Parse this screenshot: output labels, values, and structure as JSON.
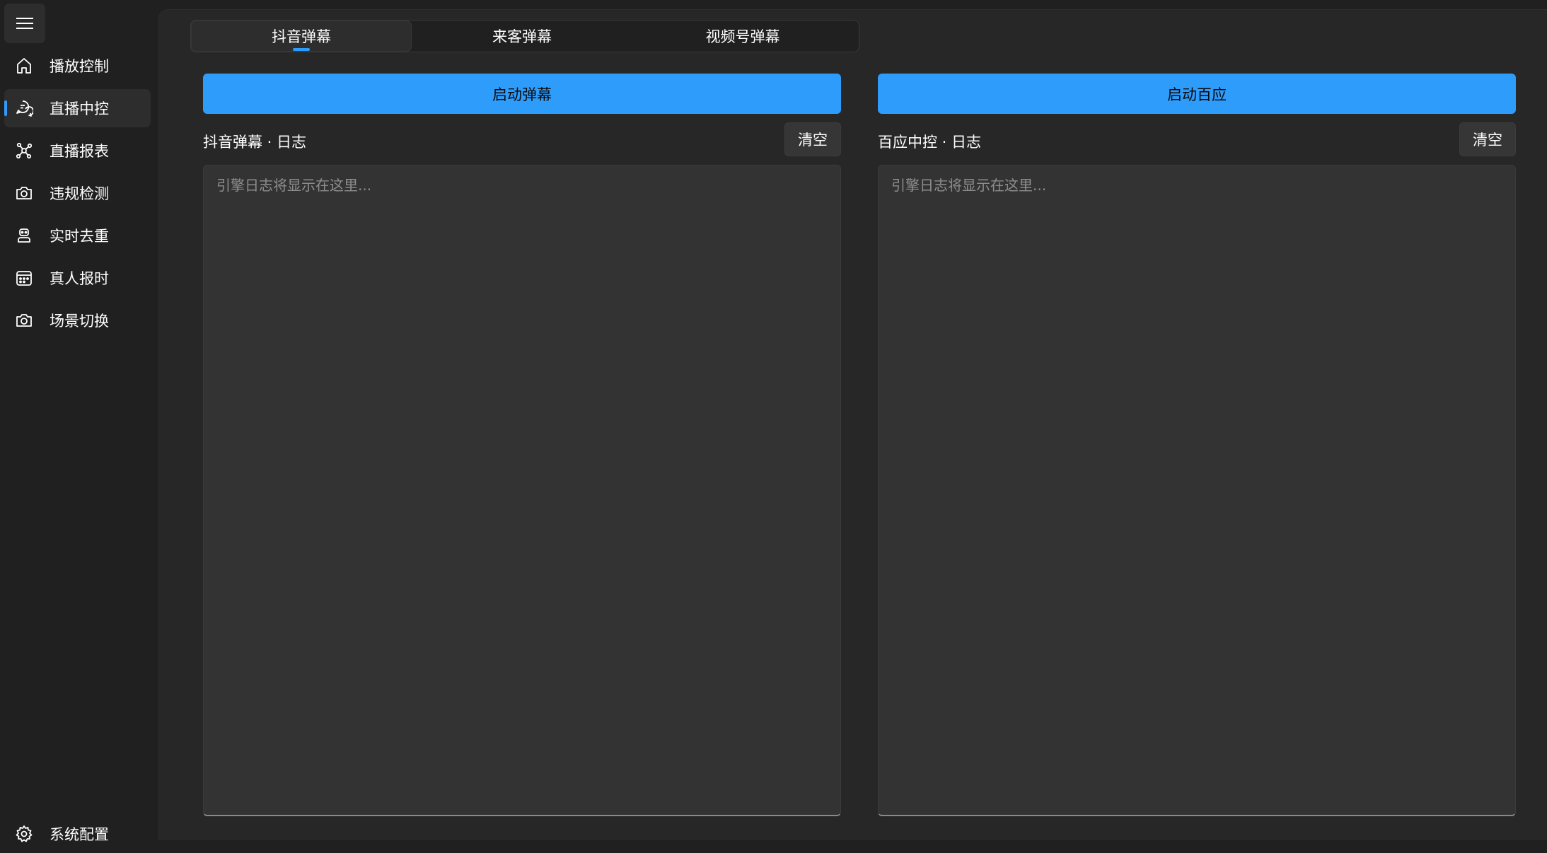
{
  "theme": {
    "accent": "#2e9cfb"
  },
  "sidebar": {
    "menu_icon": "hamburger-icon",
    "items": [
      {
        "label": "播放控制",
        "icon": "home-icon",
        "selected": false
      },
      {
        "label": "直播中控",
        "icon": "chat-icon",
        "selected": true
      },
      {
        "label": "直播报表",
        "icon": "network-icon",
        "selected": false
      },
      {
        "label": "违规检测",
        "icon": "camera-icon",
        "selected": false
      },
      {
        "label": "实时去重",
        "icon": "robot-icon",
        "selected": false
      },
      {
        "label": "真人报时",
        "icon": "calendar-icon",
        "selected": false
      },
      {
        "label": "场景切换",
        "icon": "camera-icon",
        "selected": false
      }
    ],
    "footer": {
      "label": "系统配置",
      "icon": "gear-icon"
    }
  },
  "tabs": [
    {
      "label": "抖音弹幕",
      "active": true
    },
    {
      "label": "来客弹幕",
      "active": false
    },
    {
      "label": "视频号弹幕",
      "active": false
    }
  ],
  "panes": {
    "left": {
      "start_label": "启动弹幕",
      "log_title": "抖音弹幕 · 日志",
      "clear_label": "清空",
      "placeholder": "引擎日志将显示在这里..."
    },
    "right": {
      "start_label": "启动百应",
      "log_title": "百应中控 · 日志",
      "clear_label": "清空",
      "placeholder": "引擎日志将显示在这里..."
    }
  }
}
